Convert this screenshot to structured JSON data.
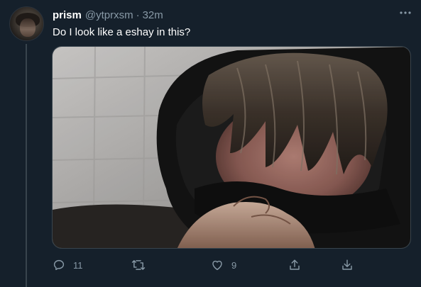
{
  "author": {
    "display_name": "prism",
    "handle": "@ytprxsm",
    "separator": "·",
    "time": "32m"
  },
  "tweet": {
    "text": "Do I look like a eshay in this?"
  },
  "icons": {
    "more": "more-horizontal-icon",
    "reply": "reply-icon",
    "retweet": "retweet-icon",
    "like": "heart-icon",
    "share": "share-icon",
    "download": "download-icon"
  },
  "actions": {
    "reply_count": "11",
    "retweet_count": "",
    "like_count": "9"
  },
  "colors": {
    "background": "#15202b",
    "secondary_text": "#8899a6",
    "border": "#38444d",
    "primary_text": "#ffffff"
  }
}
